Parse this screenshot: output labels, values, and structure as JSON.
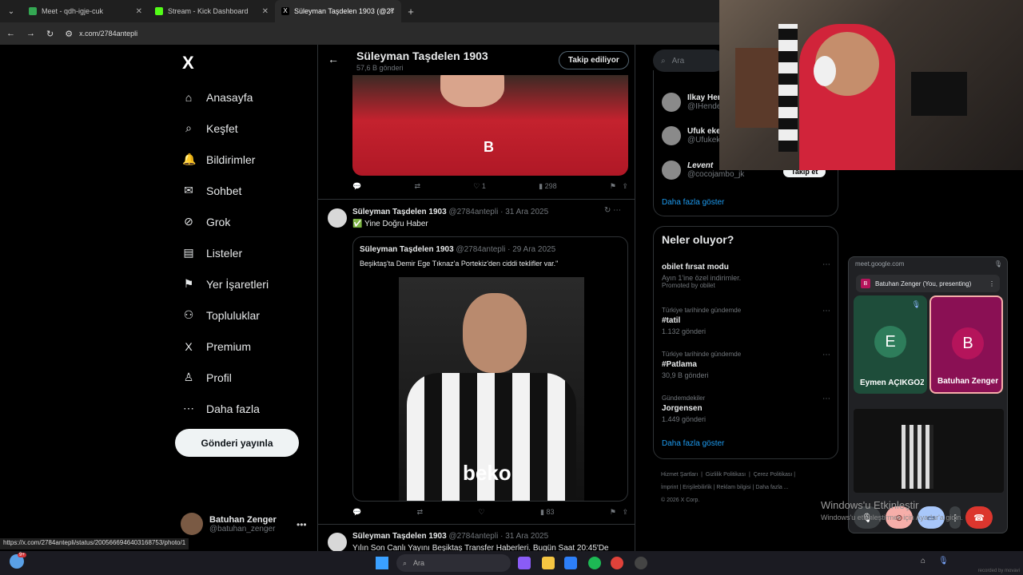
{
  "browser": {
    "tabs": [
      {
        "label": "Meet - qdh-igje-cuk",
        "color": "#34a853"
      },
      {
        "label": "Stream - Kick Dashboard",
        "color": "#53fc18"
      },
      {
        "label": "Süleyman Taşdelen 1903 (@27",
        "color": "#ffffff"
      }
    ],
    "new_tab": "+",
    "url": "x.com/2784antepli",
    "status_url": "https://x.com/2784antepli/status/2005666946403168753/photo/1"
  },
  "sidebar": {
    "logo": "X",
    "items": [
      {
        "label": "Anasayfa",
        "icon": "⌂"
      },
      {
        "label": "Keşfet",
        "icon": "⌕"
      },
      {
        "label": "Bildirimler",
        "icon": "🔔"
      },
      {
        "label": "Sohbet",
        "icon": "✉"
      },
      {
        "label": "Grok",
        "icon": "⊘"
      },
      {
        "label": "Listeler",
        "icon": "▤"
      },
      {
        "label": "Yer İşaretleri",
        "icon": "⚑"
      },
      {
        "label": "Topluluklar",
        "icon": "⚇"
      },
      {
        "label": "Premium",
        "icon": "X"
      },
      {
        "label": "Profil",
        "icon": "♙"
      },
      {
        "label": "Daha fazla",
        "icon": "⋯"
      }
    ],
    "post_button": "Gönderi yayınla",
    "account": {
      "name": "Batuhan Zenger",
      "handle": "@batuhan_zenger",
      "menu": "•••"
    }
  },
  "feed": {
    "header": {
      "name": "Süleyman Taşdelen 1903",
      "posts": "57,6 B gönderi",
      "follow_label": "Takip ediliyor"
    },
    "post1_actions": {
      "likes": "1",
      "views": "298"
    },
    "tweet2": {
      "name": "Süleyman Taşdelen 1903",
      "handle": "@2784antepli · 31 Ara 2025",
      "text": "✅ Yine Doğru Haber",
      "quote": {
        "name": "Süleyman Taşdelen 1903",
        "handle": "@2784antepli · 29 Ara 2025",
        "text": "Beşiktaş'ta Demir Ege Tıknaz'a Portekiz'den ciddi teklifler var.\"",
        "shirt_text": "beko"
      },
      "views": "83"
    },
    "tweet3": {
      "name": "Süleyman Taşdelen 1903",
      "handle": "@2784antepli · 31 Ara 2025",
      "text": "Yılın Son Canlı Yayını Beşiktaş Transfer Haberleri. Bugün Saat 20:45'De"
    }
  },
  "right": {
    "search_placeholder": "Ara",
    "who_to_follow": [
      {
        "name": "Ilkay Her",
        "handle": "@IHende"
      },
      {
        "name": "Ufuk eke",
        "handle": "@Ufukek"
      },
      {
        "name": "Levent",
        "handle": "@cocojambo_jk"
      }
    ],
    "follow_button": "Takip et",
    "show_more": "Daha fazla göster",
    "trends_title": "Neler oluyor?",
    "trends": [
      {
        "context": "",
        "title": "obilet fırsat modu",
        "sub": "Ayın 1'ine özel indirimler.",
        "promo": "Promoted by obilet"
      },
      {
        "context": "Türkiye tarihinde gündemde",
        "title": "#tatil",
        "sub": "1.132 gönderi"
      },
      {
        "context": "Türkiye tarihinde gündemde",
        "title": "#Patlama",
        "sub": "30,9 B gönderi"
      },
      {
        "context": "Gündemdekiler",
        "title": "Jorgensen",
        "sub": "1.449 gönderi"
      }
    ],
    "footer": [
      "Hizmet Şartları",
      "Gizlilik Politikası",
      "Çerez Politikası",
      "İmprint",
      "Erişilebilirlik",
      "Reklam bilgisi",
      "Daha fazla ...",
      "© 2026 X Corp."
    ]
  },
  "meet": {
    "url": "meet.google.com",
    "presenting": "Batuhan Zenger (You, presenting)",
    "tiles": [
      {
        "initial": "E",
        "name": "Eymen AÇIKGÖZ",
        "bg": "#1e4d3a",
        "circle": "#2e7d5b"
      },
      {
        "initial": "B",
        "name": "Batuhan Zenger",
        "bg": "#8a1054",
        "circle": "#b5145b"
      }
    ]
  },
  "windows": {
    "activate_title": "Windows'u Etkinleştir",
    "activate_sub": "Windows'u etkinleştirmek için Ayarlar'a gidin.",
    "search": "Ara",
    "weather_badge": "9+",
    "credit": "recorded by movavi"
  }
}
